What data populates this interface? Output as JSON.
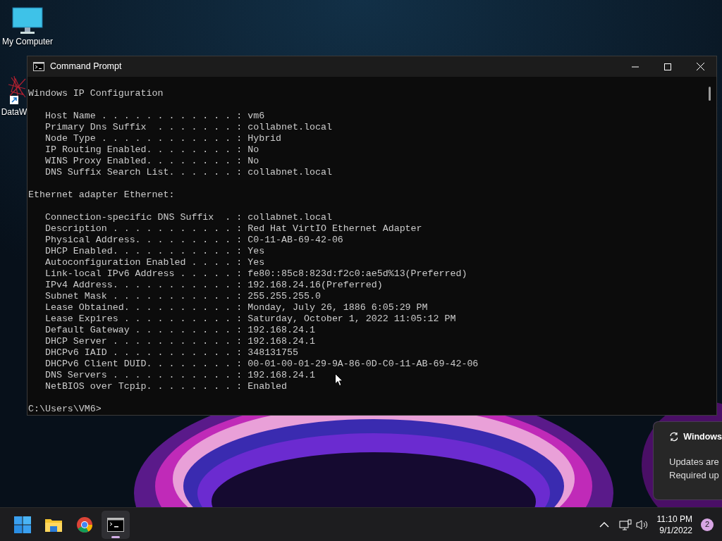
{
  "desktop_icons": [
    {
      "kind": "computer",
      "label": "My Computer"
    },
    {
      "kind": "shortcut",
      "label": "DataW"
    }
  ],
  "window": {
    "title": "Command Prompt"
  },
  "console": {
    "blocks": [
      {
        "kind": "heading",
        "lines": [
          "Windows IP Configuration"
        ]
      },
      {
        "kind": "entries",
        "lines": [
          "Host Name . . . . . . . . . . . . : vm6",
          "Primary Dns Suffix  . . . . . . . : collabnet.local",
          "Node Type . . . . . . . . . . . . : Hybrid",
          "IP Routing Enabled. . . . . . . . : No",
          "WINS Proxy Enabled. . . . . . . . : No",
          "DNS Suffix Search List. . . . . . : collabnet.local"
        ]
      },
      {
        "kind": "heading",
        "lines": [
          "Ethernet adapter Ethernet:"
        ]
      },
      {
        "kind": "entries",
        "lines": [
          "Connection-specific DNS Suffix  . : collabnet.local",
          "Description . . . . . . . . . . . : Red Hat VirtIO Ethernet Adapter",
          "Physical Address. . . . . . . . . : C0-11-AB-69-42-06",
          "DHCP Enabled. . . . . . . . . . . : Yes",
          "Autoconfiguration Enabled . . . . : Yes",
          "Link-local IPv6 Address . . . . . : fe80::85c8:823d:f2c0:ae5d%13(Preferred)",
          "IPv4 Address. . . . . . . . . . . : 192.168.24.16(Preferred)",
          "Subnet Mask . . . . . . . . . . . : 255.255.255.0",
          "Lease Obtained. . . . . . . . . . : Monday, July 26, 1886 6:05:29 PM",
          "Lease Expires . . . . . . . . . . : Saturday, October 1, 2022 11:05:12 PM",
          "Default Gateway . . . . . . . . . : 192.168.24.1",
          "DHCP Server . . . . . . . . . . . : 192.168.24.1",
          "DHCPv6 IAID . . . . . . . . . . . : 348131755",
          "DHCPv6 Client DUID. . . . . . . . : 00-01-00-01-29-9A-86-0D-C0-11-AB-69-42-06",
          "DNS Servers . . . . . . . . . . . : 192.168.24.1",
          "NetBIOS over Tcpip. . . . . . . . : Enabled"
        ]
      }
    ],
    "prompt": "C:\\Users\\VM6>"
  },
  "notification": {
    "title": "Windows",
    "lines": [
      "Updates are",
      "Required up"
    ]
  },
  "taskbar": {
    "apps": [
      {
        "kind": "start",
        "selected": false
      },
      {
        "kind": "files",
        "selected": false
      },
      {
        "kind": "browser",
        "selected": false
      },
      {
        "kind": "terminal",
        "selected": true
      }
    ],
    "clock": {
      "time": "11:10 PM",
      "date": "9/1/2022"
    },
    "notification_count": "2"
  }
}
